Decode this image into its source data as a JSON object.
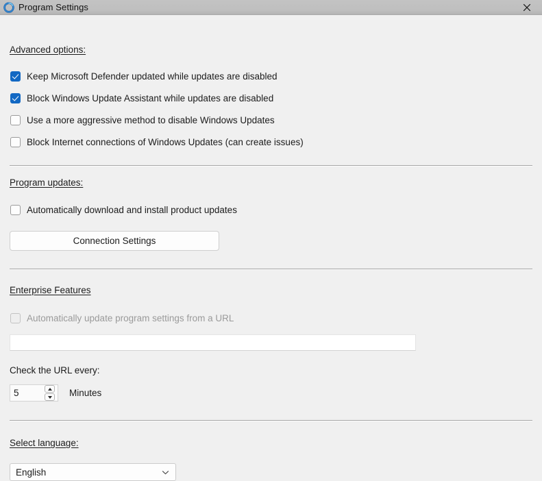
{
  "window": {
    "title": "Program Settings",
    "icon": "circular-ring-icon",
    "close_label": "✕",
    "titlebar_color": "#bfbfbf",
    "body_color": "#f0f0f0"
  },
  "sections": {
    "advanced": {
      "heading": "Advanced options:",
      "checkboxes": [
        {
          "label": "Keep Microsoft Defender updated while updates are disabled",
          "checked": true,
          "disabled": false
        },
        {
          "label": "Block Windows Update Assistant while updates are disabled",
          "checked": true,
          "disabled": false
        },
        {
          "label": "Use a more aggressive method to disable Windows Updates",
          "checked": false,
          "disabled": false
        },
        {
          "label": "Block Internet connections of Windows Updates (can create issues)",
          "checked": false,
          "disabled": false
        }
      ]
    },
    "program_updates": {
      "heading": "Program updates:",
      "auto_update": {
        "label": "Automatically download and install product updates",
        "checked": false,
        "disabled": false
      },
      "connection_settings_button": "Connection Settings"
    },
    "enterprise": {
      "heading": "Enterprise Features",
      "auto_settings_url": {
        "label": "Automatically update program settings from a URL",
        "checked": false,
        "disabled": true
      },
      "url_value": "",
      "url_placeholder": "",
      "interval_label": "Check the URL every:",
      "interval_value": "5",
      "interval_units": "Minutes"
    },
    "language": {
      "heading": "Select language:",
      "selected": "English"
    }
  },
  "accent_color": "#1268c3"
}
